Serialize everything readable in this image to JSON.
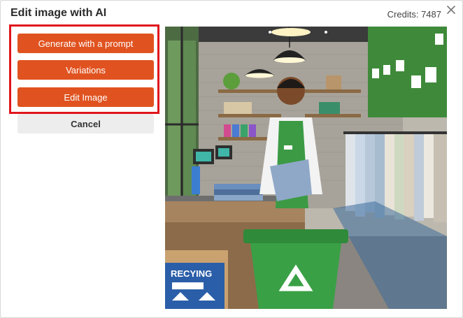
{
  "dialog": {
    "title": "Edit image with AI",
    "credits": "Credits: 7487"
  },
  "actions": {
    "generate_label": "Generate with a prompt",
    "variations_label": "Variations",
    "edit_label": "Edit Image",
    "cancel_label": "Cancel"
  },
  "preview": {
    "sign_text": "RECYING"
  },
  "colors": {
    "accent": "#e05320",
    "highlight_border": "#e0161c"
  },
  "icons": {
    "close": "close-icon",
    "recycle": "recycle-icon"
  }
}
